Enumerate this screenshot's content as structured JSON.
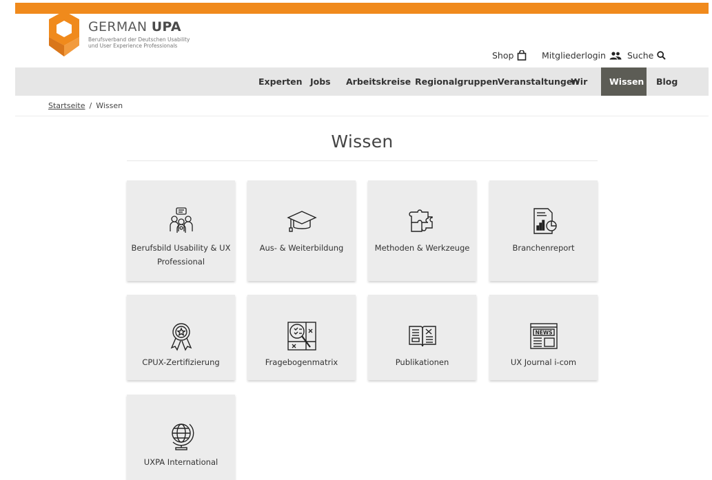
{
  "brand": {
    "name_light": "GERMAN ",
    "name_bold": "UPA",
    "subtitle_line1": "Berufsverband der Deutschen Usability",
    "subtitle_line2": "und User Experience Professionals",
    "accent_color": "#f08a1c"
  },
  "top_links": {
    "shop": "Shop",
    "login": "Mitgliederlogin",
    "search": "Suche"
  },
  "nav": {
    "items": [
      {
        "label": "Experten"
      },
      {
        "label": "Jobs"
      },
      {
        "label": "Arbeitskreise"
      },
      {
        "label": "Regionalgruppen"
      },
      {
        "label": "Veranstaltungen"
      },
      {
        "label": "Wir"
      },
      {
        "label": "Wissen",
        "active": true
      },
      {
        "label": "Blog"
      }
    ]
  },
  "breadcrumb": {
    "home": "Startseite",
    "separator": "/",
    "current": "Wissen"
  },
  "page": {
    "title": "Wissen"
  },
  "tiles": [
    {
      "label": "Berufsbild Usability & UX Professional",
      "icon": "people-discussion-icon"
    },
    {
      "label": "Aus- & Weiterbildung",
      "icon": "graduation-cap-icon"
    },
    {
      "label": "Methoden & Werkzeuge",
      "icon": "puzzle-icon"
    },
    {
      "label": "Branchenreport",
      "icon": "report-chart-icon"
    },
    {
      "label": "CPUX-Zertifizierung",
      "icon": "award-ribbon-icon"
    },
    {
      "label": "Fragebogenmatrix",
      "icon": "magnifier-checklist-icon"
    },
    {
      "label": "Publikationen",
      "icon": "open-book-icon"
    },
    {
      "label": "UX Journal i-com",
      "icon": "newspaper-icon"
    },
    {
      "label": "UXPA International",
      "icon": "globe-icon"
    }
  ],
  "news_icon_text": "NEWS"
}
